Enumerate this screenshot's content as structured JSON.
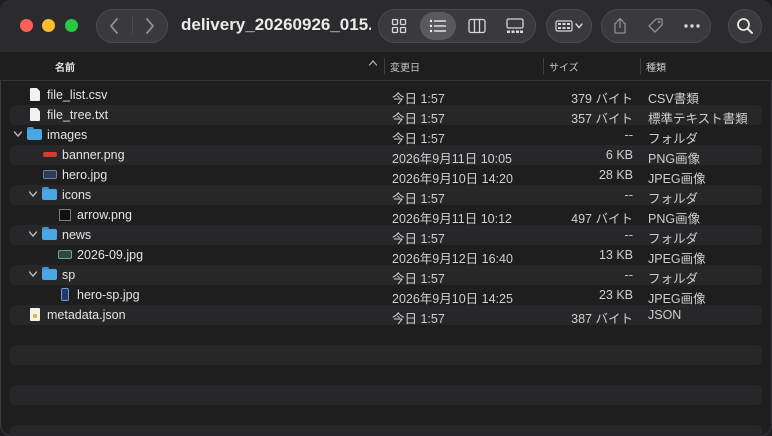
{
  "window": {
    "title": "delivery_20260926_015..."
  },
  "toolbar": {
    "back_icon": "chevron-left",
    "forward_icon": "chevron-right",
    "view_modes": [
      "icon-view",
      "list-view",
      "column-view",
      "gallery-view"
    ],
    "active_view": "list-view",
    "group_icon": "group-by-grid",
    "actions": [
      "share",
      "tag",
      "more"
    ],
    "search_icon": "search"
  },
  "columns": {
    "name": "名前",
    "date": "変更日",
    "size": "サイズ",
    "kind": "種類",
    "sort_indicator": "^"
  },
  "files": [
    {
      "name": "file_list.csv",
      "date": "今日 1:57",
      "size": "379 バイト",
      "kind": "CSV書類",
      "depth": 0,
      "type": "doc",
      "expandable": false
    },
    {
      "name": "file_tree.txt",
      "date": "今日 1:57",
      "size": "357 バイト",
      "kind": "標準テキスト書類",
      "depth": 0,
      "type": "doc",
      "expandable": false
    },
    {
      "name": "images",
      "date": "今日 1:57",
      "size": "--",
      "kind": "フォルダ",
      "depth": 0,
      "type": "folder",
      "expandable": true
    },
    {
      "name": "banner.png",
      "date": "2026年9月11日 10:05",
      "size": "6 KB",
      "kind": "PNG画像",
      "depth": 1,
      "type": "banner",
      "expandable": false
    },
    {
      "name": "hero.jpg",
      "date": "2026年9月10日 14:20",
      "size": "28 KB",
      "kind": "JPEG画像",
      "depth": 1,
      "type": "img",
      "expandable": false
    },
    {
      "name": "icons",
      "date": "今日 1:57",
      "size": "--",
      "kind": "フォルダ",
      "depth": 1,
      "type": "folder",
      "expandable": true
    },
    {
      "name": "arrow.png",
      "date": "2026年9月11日 10:12",
      "size": "497 バイト",
      "kind": "PNG画像",
      "depth": 2,
      "type": "arrow",
      "expandable": false
    },
    {
      "name": "news",
      "date": "今日 1:57",
      "size": "--",
      "kind": "フォルダ",
      "depth": 1,
      "type": "folder",
      "expandable": true
    },
    {
      "name": "2026-09.jpg",
      "date": "2026年9月12日 16:40",
      "size": "13 KB",
      "kind": "JPEG画像",
      "depth": 2,
      "type": "news",
      "expandable": false
    },
    {
      "name": "sp",
      "date": "今日 1:57",
      "size": "--",
      "kind": "フォルダ",
      "depth": 1,
      "type": "folder",
      "expandable": true
    },
    {
      "name": "hero-sp.jpg",
      "date": "2026年9月10日 14:25",
      "size": "23 KB",
      "kind": "JPEG画像",
      "depth": 2,
      "type": "phone",
      "expandable": false
    },
    {
      "name": "metadata.json",
      "date": "今日 1:57",
      "size": "387 バイト",
      "kind": "JSON",
      "depth": 0,
      "type": "json",
      "expandable": false
    }
  ]
}
